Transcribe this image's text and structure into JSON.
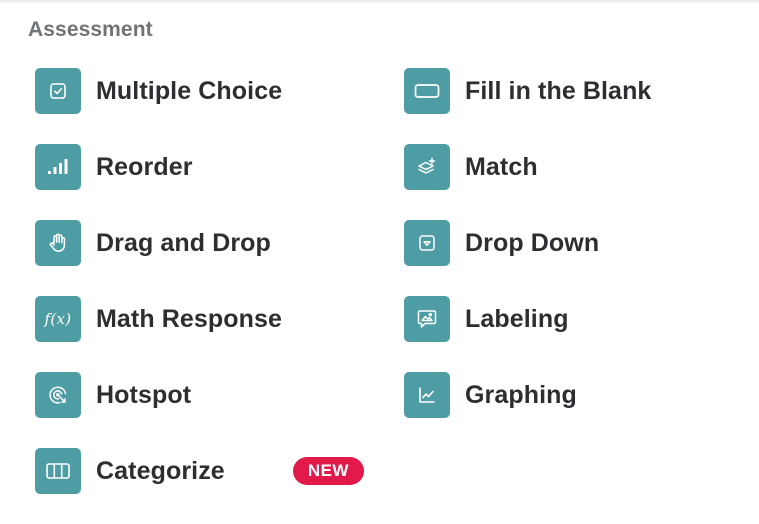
{
  "section": {
    "title": "Assessment"
  },
  "colors": {
    "icon_bg": "#4f9da4",
    "text": "#2c2e31",
    "title": "#707478",
    "badge_bg": "#e2194b"
  },
  "left_items": [
    {
      "label": "Multiple Choice",
      "icon": "checkbox-icon"
    },
    {
      "label": "Reorder",
      "icon": "bars-icon"
    },
    {
      "label": "Drag and Drop",
      "icon": "hand-icon"
    },
    {
      "label": "Math Response",
      "icon": "function-icon",
      "icon_text": "f(x)"
    },
    {
      "label": "Hotspot",
      "icon": "target-icon"
    },
    {
      "label": "Categorize",
      "icon": "columns-icon",
      "badge": "NEW"
    }
  ],
  "right_items": [
    {
      "label": "Fill in the Blank",
      "icon": "blank-box-icon"
    },
    {
      "label": "Match",
      "icon": "layers-icon"
    },
    {
      "label": "Drop Down",
      "icon": "dropdown-icon"
    },
    {
      "label": "Labeling",
      "icon": "image-label-icon"
    },
    {
      "label": "Graphing",
      "icon": "line-chart-icon"
    }
  ]
}
